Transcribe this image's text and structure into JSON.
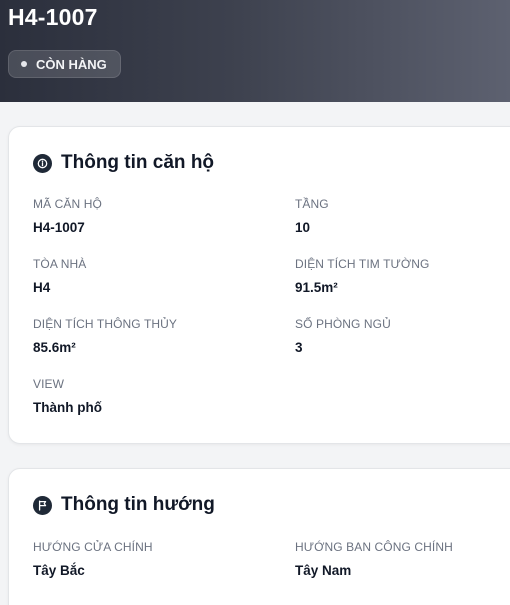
{
  "header": {
    "title": "H4-1007",
    "status": "CÒN HÀNG"
  },
  "apartment_info": {
    "title": "Thông tin căn hộ",
    "fields": [
      {
        "label": "MÃ CĂN HỘ",
        "value": "H4-1007"
      },
      {
        "label": "TẦNG",
        "value": "10"
      },
      {
        "label": "TÒA NHÀ",
        "value": "H4"
      },
      {
        "label": "DIỆN TÍCH TIM TƯỜNG",
        "value": "91.5m²"
      },
      {
        "label": "DIỆN TÍCH THÔNG THỦY",
        "value": "85.6m²"
      },
      {
        "label": "SỐ PHÒNG NGỦ",
        "value": "3"
      },
      {
        "label": "VIEW",
        "value": "Thành phố"
      }
    ]
  },
  "direction_info": {
    "title": "Thông tin hướng",
    "fields": [
      {
        "label": "HƯỚNG CỬA CHÍNH",
        "value": "Tây Bắc"
      },
      {
        "label": "HƯỚNG BAN CÔNG CHÍNH",
        "value": "Tây Nam"
      }
    ]
  }
}
